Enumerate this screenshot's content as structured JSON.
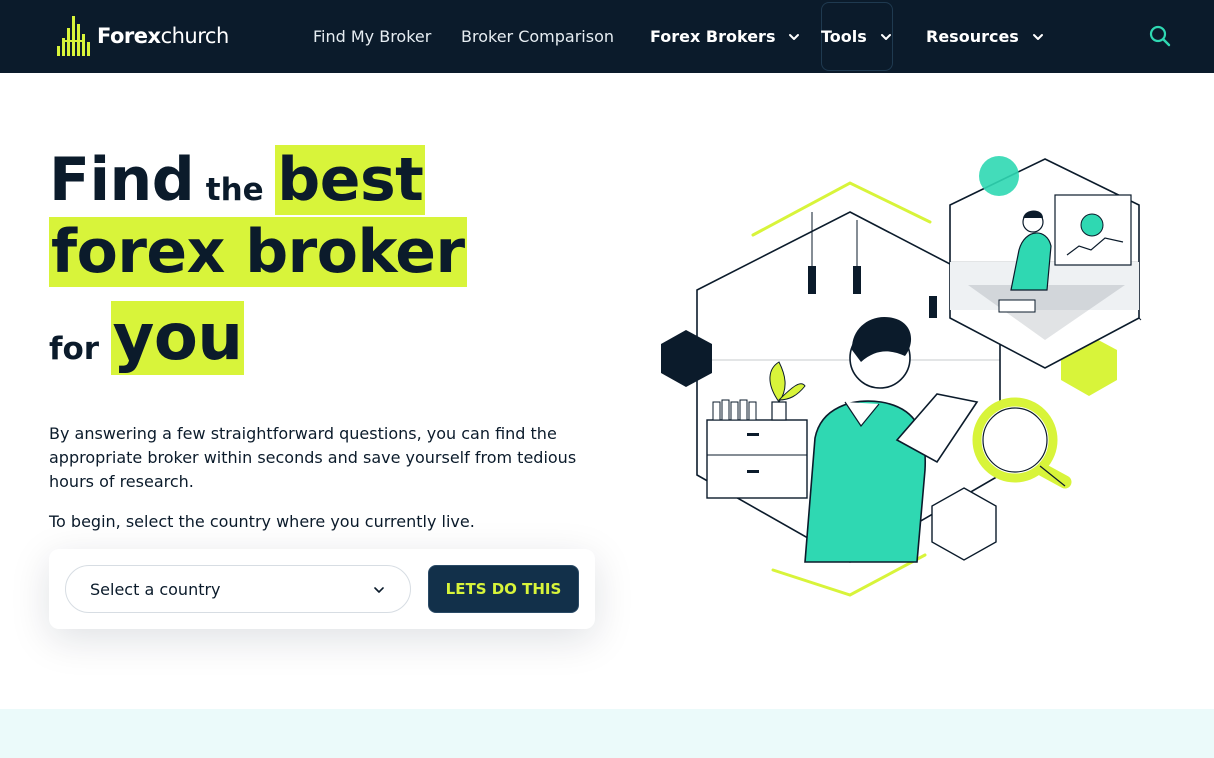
{
  "brand": {
    "name_bold": "Forex",
    "name_light": "church"
  },
  "nav": {
    "items": [
      {
        "label": "Find My Broker"
      },
      {
        "label": "Broker Comparison"
      },
      {
        "label": "Forex Brokers"
      },
      {
        "label": "Tools"
      },
      {
        "label": "Resources"
      }
    ]
  },
  "hero": {
    "w1": "Find",
    "w2": "the",
    "w3": "best",
    "w4": "forex broker",
    "w5": "for",
    "w6": "you",
    "description": "By answering a few straightforward questions, you can find the appropriate broker within seconds and save yourself from tedious hours of research.",
    "prompt": "To begin, select the country where you currently live."
  },
  "form": {
    "country_select": "Select a country",
    "cta_label": "LETS DO THIS"
  },
  "colors": {
    "navy": "#0b1b2b",
    "lime": "#d8f43a",
    "teal": "#2fd8b2",
    "band": "#ebfafa"
  },
  "icons": [
    "logo-bars-icon",
    "chevron-down-icon",
    "search-icon"
  ]
}
